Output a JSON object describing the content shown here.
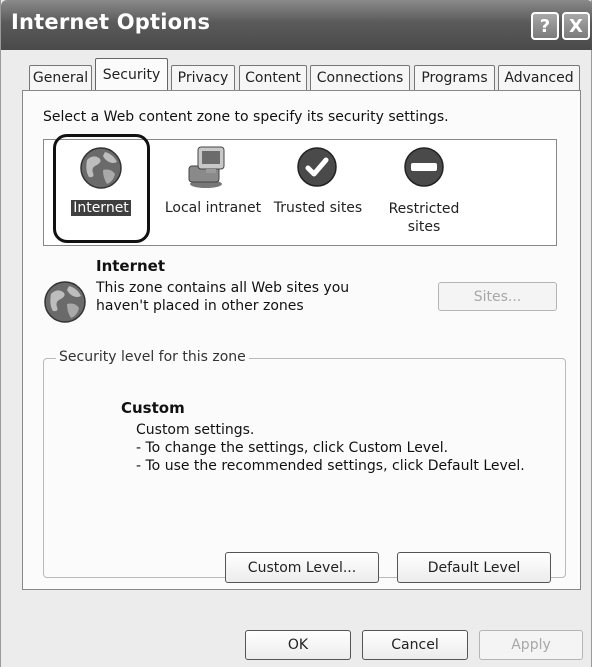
{
  "window": {
    "title": "Internet Options"
  },
  "titlebar_buttons": {
    "help": "?",
    "close": "X"
  },
  "tabs": [
    "General",
    "Security",
    "Privacy",
    "Content",
    "Connections",
    "Programs",
    "Advanced"
  ],
  "active_tab": "Security",
  "instructions": "Select a Web content zone to specify its security settings.",
  "zones": [
    {
      "label": "Internet",
      "icon": "globe-icon",
      "selected": true
    },
    {
      "label": "Local intranet",
      "icon": "computer-icon"
    },
    {
      "label": "Trusted sites",
      "icon": "checkmark-icon"
    },
    {
      "label": "Restricted sites",
      "label_line1": "Restricted",
      "label_line2": "sites",
      "icon": "no-entry-icon"
    }
  ],
  "zone_info": {
    "title": "Internet",
    "description_line1": "This zone contains all Web sites you",
    "description_line2": "haven't placed in other zones",
    "sites_button": "Sites..."
  },
  "security_level": {
    "legend": "Security level for this zone",
    "title": "Custom",
    "lines": [
      "Custom settings.",
      "- To change the settings, click Custom Level.",
      "- To use the recommended settings, click Default Level."
    ],
    "custom_button": "Custom Level...",
    "default_button": "Default Level"
  },
  "footer": {
    "ok": "OK",
    "cancel": "Cancel",
    "apply": "Apply"
  }
}
